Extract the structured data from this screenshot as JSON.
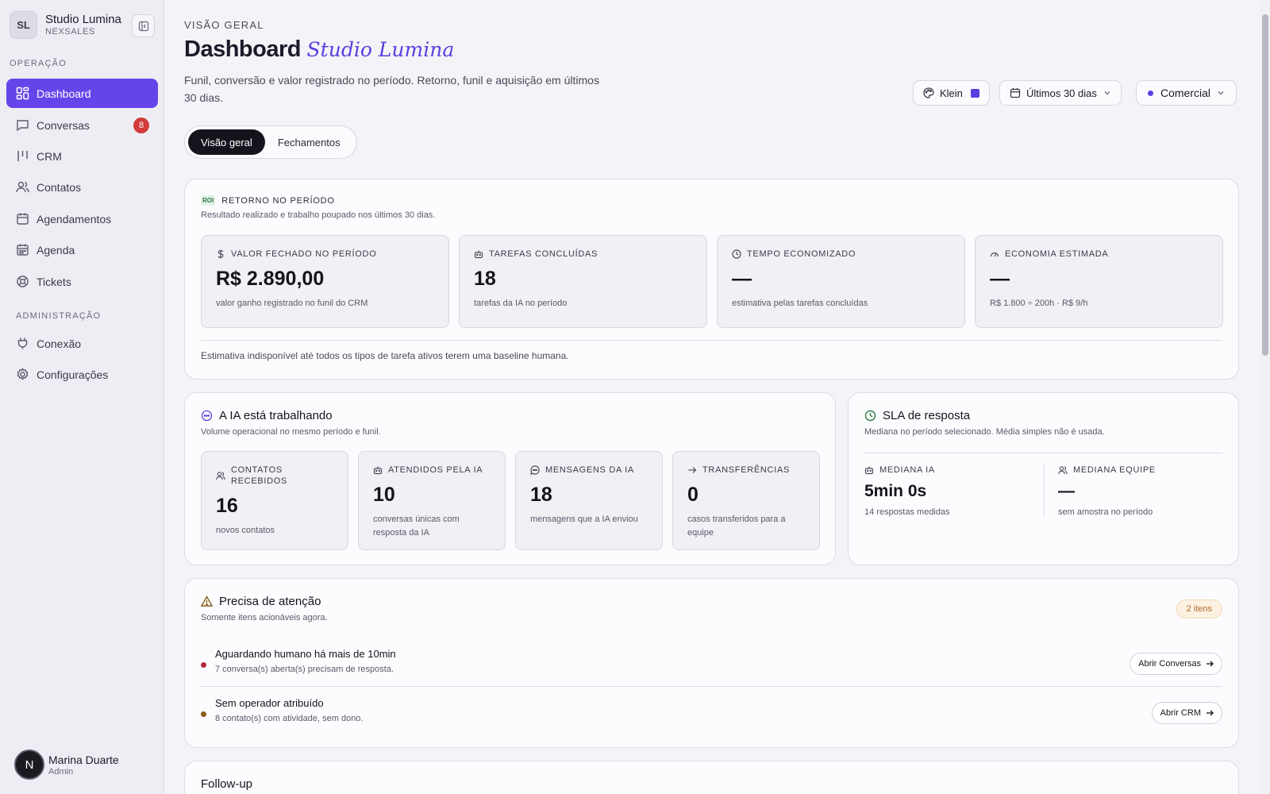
{
  "workspace": {
    "initials": "SL",
    "name": "Studio Lumina",
    "product": "NEXSALES"
  },
  "sidebar": {
    "section_operacao": "OPERAÇÃO",
    "section_admin": "ADMINISTRAÇÃO",
    "items": [
      {
        "label": "Dashboard",
        "icon": "dashboard-icon"
      },
      {
        "label": "Conversas",
        "icon": "chat-icon",
        "badge": "8"
      },
      {
        "label": "CRM",
        "icon": "kanban-icon"
      },
      {
        "label": "Contatos",
        "icon": "users-icon"
      },
      {
        "label": "Agendamentos",
        "icon": "calendar-icon"
      },
      {
        "label": "Agenda",
        "icon": "calendar-grid-icon"
      },
      {
        "label": "Tickets",
        "icon": "lifebuoy-icon"
      }
    ],
    "admin_items": [
      {
        "label": "Conexão",
        "icon": "plug-icon"
      },
      {
        "label": "Configurações",
        "icon": "gear-icon"
      }
    ]
  },
  "user": {
    "initial": "N",
    "name": "Marina Duarte",
    "role": "Admin"
  },
  "header": {
    "eyebrow": "VISÃO GERAL",
    "title": "Dashboard",
    "title_accent": "Studio Lumina",
    "subtitle": "Funil, conversão e valor registrado no período. Retorno, funil e aquisição em últimos 30 dias.",
    "theme_label": "Klein",
    "theme_color": "#5b3fe0",
    "period_label": "Últimos 30 dias",
    "funnel_label": "Comercial"
  },
  "tabs": [
    {
      "label": "Visão geral"
    },
    {
      "label": "Fechamentos"
    }
  ],
  "roi": {
    "badge": "ROI",
    "kicker": "RETORNO NO PERÍODO",
    "desc": "Resultado realizado e trabalho poupado nos últimos 30 dias.",
    "metrics": [
      {
        "label": "VALOR FECHADO NO PERÍODO",
        "icon": "dollar-icon",
        "value": "R$ 2.890,00",
        "caption": "valor ganho registrado no funil do CRM"
      },
      {
        "label": "TAREFAS CONCLUÍDAS",
        "icon": "bot-icon",
        "value": "18",
        "caption": "tarefas da IA no período"
      },
      {
        "label": "TEMPO ECONOMIZADO",
        "icon": "clock-icon",
        "value": "—",
        "caption": "estimativa pelas tarefas concluídas"
      },
      {
        "label": "ECONOMIA ESTIMADA",
        "icon": "gauge-icon",
        "value": "—",
        "caption": "R$ 1.800 ÷ 200h · R$ 9/h"
      }
    ],
    "footnote": "Estimativa indisponível até todos os tipos de tarefa ativos terem uma baseline humana."
  },
  "ai": {
    "title": "A IA está trabalhando",
    "desc": "Volume operacional no mesmo período e funil.",
    "metrics": [
      {
        "label": "CONTATOS RECEBIDOS",
        "icon": "users-icon",
        "value": "16",
        "caption": "novos contatos"
      },
      {
        "label": "ATENDIDOS PELA IA",
        "icon": "bot-icon",
        "value": "10",
        "caption": "conversas únicas com resposta da IA"
      },
      {
        "label": "MENSAGENS DA IA",
        "icon": "chat-icon",
        "value": "18",
        "caption": "mensagens que a IA enviou"
      },
      {
        "label": "TRANSFERÊNCIAS",
        "icon": "arrow-right-icon",
        "value": "0",
        "caption": "casos transferidos para a equipe"
      }
    ]
  },
  "sla": {
    "title": "SLA de resposta",
    "desc": "Mediana no período selecionado. Média simples não é usada.",
    "ai_label": "MEDIANA IA",
    "ai_value": "5min 0s",
    "ai_caption": "14 respostas medidas",
    "team_label": "MEDIANA EQUIPE",
    "team_value": "—",
    "team_caption": "sem amostra no período"
  },
  "attention": {
    "title": "Precisa de atenção",
    "desc": "Somente itens acionáveis agora.",
    "count": "2 itens",
    "items": [
      {
        "title": "Aguardando humano há mais de 10min",
        "sub": "7 conversa(s) aberta(s) precisam de resposta.",
        "action": "Abrir Conversas",
        "color": "#b3283a"
      },
      {
        "title": "Sem operador atribuído",
        "sub": "8 contato(s) com atividade, sem dono.",
        "action": "Abrir CRM",
        "color": "#8a5a1c"
      }
    ]
  },
  "followup": {
    "title": "Follow-up"
  }
}
